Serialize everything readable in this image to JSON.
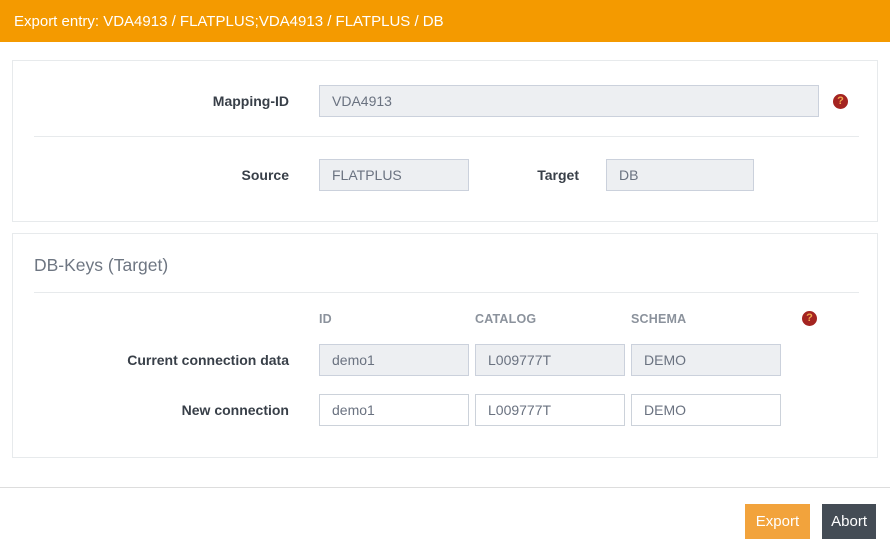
{
  "titlebar": {
    "title": "Export entry: VDA4913 / FLATPLUS;VDA4913 / FLATPLUS / DB"
  },
  "icons": {
    "help_glyph": "?"
  },
  "mapping_panel": {
    "mapping_id_label": "Mapping-ID",
    "mapping_id_value": "VDA4913",
    "source_label": "Source",
    "source_value": "FLATPLUS",
    "target_label": "Target",
    "target_value": "DB"
  },
  "dbkeys_panel": {
    "heading": "DB-Keys (Target)",
    "columns": [
      "ID",
      "CATALOG",
      "SCHEMA"
    ],
    "rows": [
      {
        "label": "Current connection data",
        "id": "demo1",
        "catalog": "L009777T",
        "schema": "DEMO",
        "readonly": true
      },
      {
        "label": "New connection",
        "id": "demo1",
        "catalog": "L009777T",
        "schema": "DEMO",
        "readonly": false
      }
    ]
  },
  "footer": {
    "export_label": "Export",
    "abort_label": "Abort"
  },
  "colors": {
    "titlebar_bg": "#f49a00",
    "export_button_bg": "#f2a33c",
    "abort_button_bg": "#444c55",
    "help_icon_bg": "#a42421",
    "help_icon_glyph": "#f2a94f",
    "disabled_input_bg": "#edeff2",
    "panel_border": "#e7eaec"
  }
}
